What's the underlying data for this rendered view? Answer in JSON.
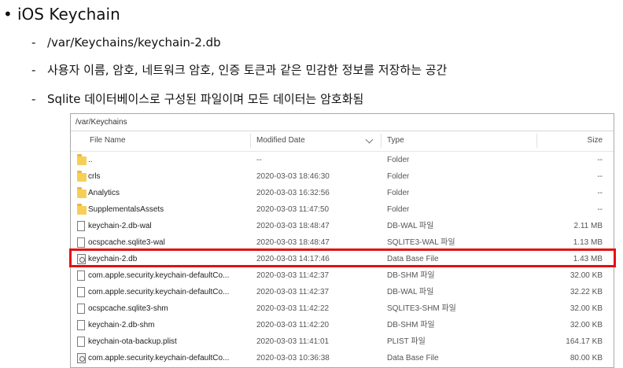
{
  "slide": {
    "bullet_glyph": "•",
    "title": "iOS Keychain",
    "subitems": [
      {
        "dash": "-",
        "text": "/var/Keychains/keychain-2.db"
      },
      {
        "dash": "-",
        "text": "사용자 이름, 암호, 네트워크 암호, 인증 토큰과 같은 민감한 정보를 저장하는 공간"
      },
      {
        "dash": "-",
        "text": "Sqlite 데이터베이스로 구성된 파일이며 모든 데이터는 암호화됨"
      }
    ]
  },
  "explorer": {
    "path": "/var/Keychains",
    "columns": {
      "name": "File Name",
      "modified": "Modified Date",
      "type": "Type",
      "size": "Size"
    },
    "rows": [
      {
        "icon": "folder-icon",
        "name": "..",
        "date": "--",
        "type": "Folder",
        "size": "--"
      },
      {
        "icon": "folder-icon",
        "name": "crls",
        "date": "2020-03-03 18:46:30",
        "type": "Folder",
        "size": "--"
      },
      {
        "icon": "folder-icon",
        "name": "Analytics",
        "date": "2020-03-03 16:32:56",
        "type": "Folder",
        "size": "--"
      },
      {
        "icon": "folder-icon",
        "name": "SupplementalsAssets",
        "date": "2020-03-03 11:47:50",
        "type": "Folder",
        "size": "--"
      },
      {
        "icon": "file-icon",
        "name": "keychain-2.db-wal",
        "date": "2020-03-03 18:48:47",
        "type": "DB-WAL 파일",
        "size": "2.11 MB"
      },
      {
        "icon": "file-icon",
        "name": "ocspcache.sqlite3-wal",
        "date": "2020-03-03 18:48:47",
        "type": "SQLITE3-WAL 파일",
        "size": "1.13 MB"
      },
      {
        "icon": "database-icon",
        "name": "keychain-2.db",
        "date": "2020-03-03 14:17:46",
        "type": "Data Base File",
        "size": "1.43 MB"
      },
      {
        "icon": "file-icon",
        "name": "com.apple.security.keychain-defaultCo...",
        "date": "2020-03-03 11:42:37",
        "type": "DB-SHM 파일",
        "size": "32.00 KB"
      },
      {
        "icon": "file-icon",
        "name": "com.apple.security.keychain-defaultCo...",
        "date": "2020-03-03 11:42:37",
        "type": "DB-WAL 파일",
        "size": "32.22 KB"
      },
      {
        "icon": "file-icon",
        "name": "ocspcache.sqlite3-shm",
        "date": "2020-03-03 11:42:22",
        "type": "SQLITE3-SHM 파일",
        "size": "32.00 KB"
      },
      {
        "icon": "file-icon",
        "name": "keychain-2.db-shm",
        "date": "2020-03-03 11:42:20",
        "type": "DB-SHM 파일",
        "size": "32.00 KB"
      },
      {
        "icon": "file-icon",
        "name": "keychain-ota-backup.plist",
        "date": "2020-03-03 11:41:01",
        "type": "PLIST 파일",
        "size": "164.17 KB"
      },
      {
        "icon": "database-icon",
        "name": "com.apple.security.keychain-defaultCo...",
        "date": "2020-03-03 10:36:38",
        "type": "Data Base File",
        "size": "80.00 KB"
      }
    ],
    "highlight_color": "#e41010"
  }
}
